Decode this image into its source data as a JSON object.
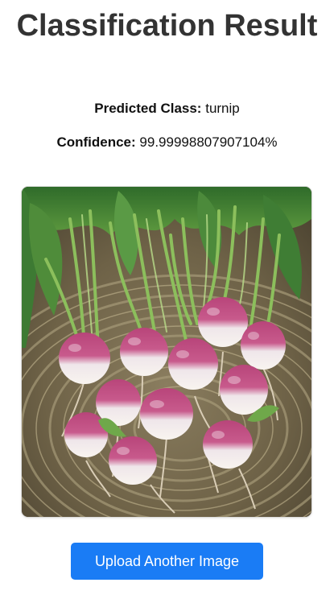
{
  "page": {
    "title": "Classification Result"
  },
  "result": {
    "predicted_label": "Predicted Class:",
    "predicted_value": "turnip",
    "confidence_label": "Confidence:",
    "confidence_value": "99.99998807907104%"
  },
  "image": {
    "subject": "turnips-in-wicker-basket"
  },
  "actions": {
    "upload_label": "Upload Another Image"
  },
  "colors": {
    "button": "#1a7cf5",
    "title": "#333333",
    "turnip_top": "#b8457a",
    "turnip_bottom": "#f4eee8"
  }
}
